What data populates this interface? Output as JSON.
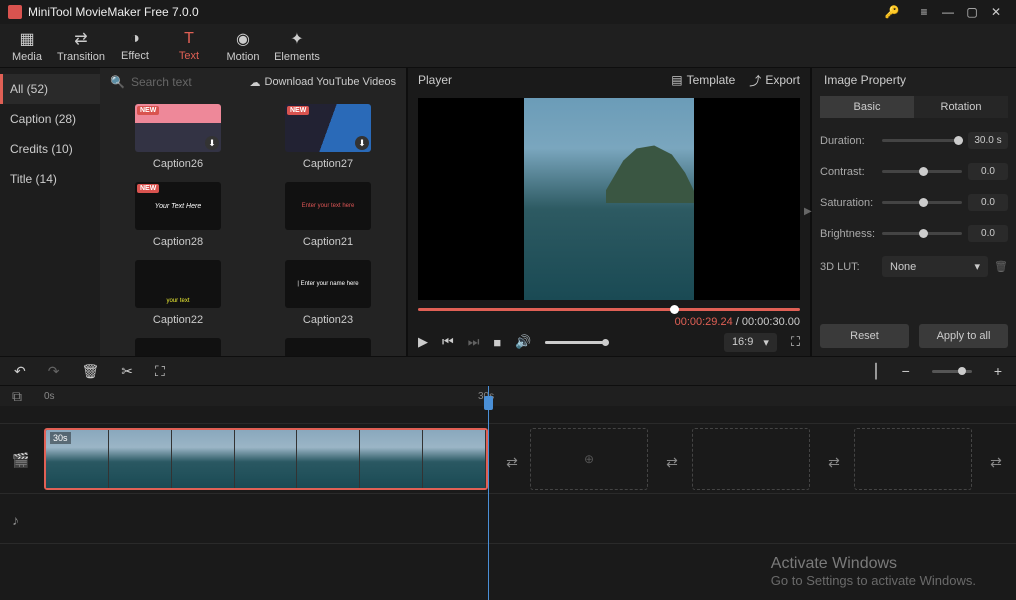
{
  "app": {
    "title": "MiniTool MovieMaker Free 7.0.0"
  },
  "mainTabs": [
    {
      "label": "Media"
    },
    {
      "label": "Transition"
    },
    {
      "label": "Effect"
    },
    {
      "label": "Text"
    },
    {
      "label": "Motion"
    },
    {
      "label": "Elements"
    }
  ],
  "categories": [
    {
      "label": "All (52)"
    },
    {
      "label": "Caption (28)"
    },
    {
      "label": "Credits (10)"
    },
    {
      "label": "Title (14)"
    }
  ],
  "search": {
    "placeholder": "Search text"
  },
  "ytLink": "Download YouTube Videos",
  "captions": [
    {
      "name": "Caption26",
      "isNew": true
    },
    {
      "name": "Caption27",
      "isNew": true
    },
    {
      "name": "Caption28",
      "isNew": true
    },
    {
      "name": "Caption21",
      "isNew": false
    },
    {
      "name": "Caption22",
      "isNew": false
    },
    {
      "name": "Caption23",
      "isNew": false
    }
  ],
  "player": {
    "title": "Player",
    "templateBtn": "Template",
    "exportBtn": "Export",
    "currentTime": "00:00:29.24",
    "sep": " / ",
    "totalTime": "00:00:30.00",
    "aspect": "16:9"
  },
  "props": {
    "title": "Image Property",
    "tabBasic": "Basic",
    "tabRotation": "Rotation",
    "durationLabel": "Duration:",
    "durationVal": "30.0 s",
    "contrastLabel": "Contrast:",
    "contrastVal": "0.0",
    "saturationLabel": "Saturation:",
    "saturationVal": "0.0",
    "brightnessLabel": "Brightness:",
    "brightnessVal": "0.0",
    "lutLabel": "3D LUT:",
    "lutVal": "None",
    "resetBtn": "Reset",
    "applyBtn": "Apply to all"
  },
  "timeline": {
    "t0": "0s",
    "t30": "30s",
    "clipDur": "30s"
  },
  "watermark": {
    "line1": "Activate Windows",
    "line2": "Go to Settings to activate Windows."
  }
}
